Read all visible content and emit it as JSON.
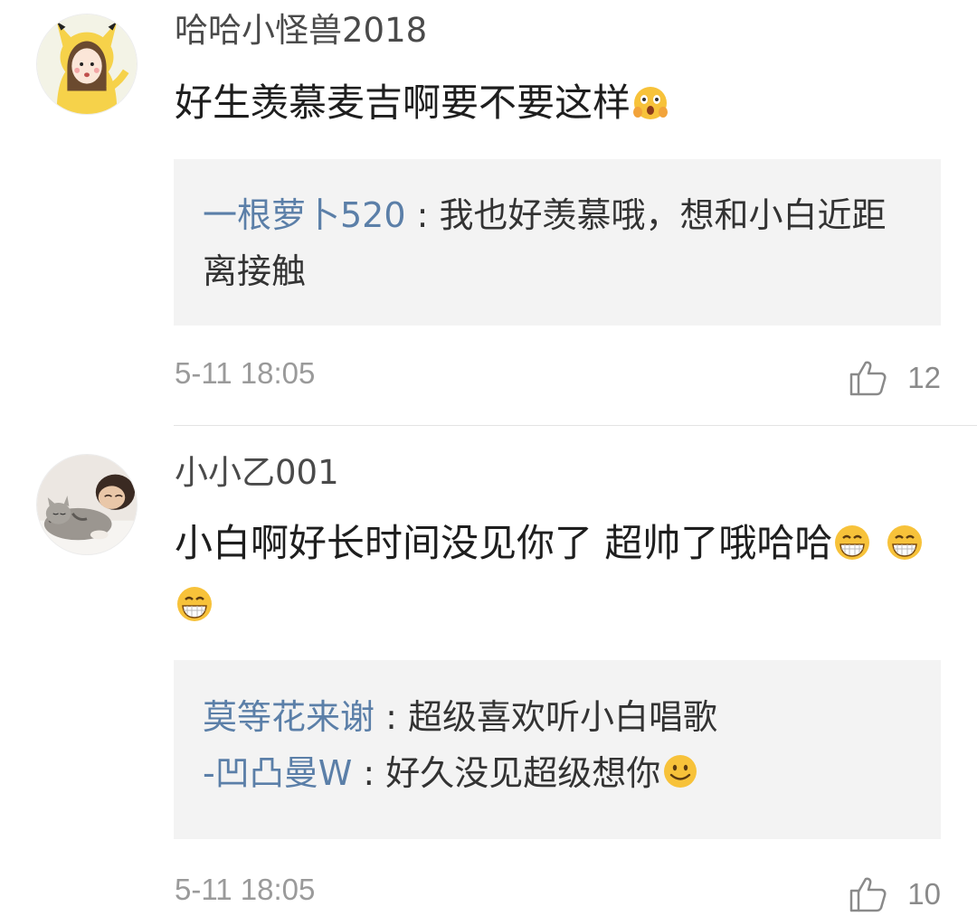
{
  "comments": [
    {
      "username": "哈哈小怪兽2018",
      "text": "好生羡慕麦吉啊要不要这样",
      "emoji_icon": "scared-face-emoji",
      "avatar_icon": "pikachu-hoodie-girl-avatar",
      "replies": [
        {
          "author": "一根萝卜520",
          "separator": " : ",
          "text": "我也好羡慕哦，想和小白近距离接触"
        }
      ],
      "timestamp": "5-11 18:05",
      "likes": "12"
    },
    {
      "username": "小小乙001",
      "text": "小白啊好长时间没见你了 超帅了哦哈哈",
      "emoji_icon": "grinning-face-emoji",
      "avatar_icon": "sleeping-cat-avatar",
      "replies": [
        {
          "author": "莫等花来谢",
          "separator": " : ",
          "text": "超级喜欢听小白唱歌"
        },
        {
          "author": "-凹凸曼W",
          "separator": " : ",
          "text": "好久没见超级想你",
          "emoji_icon": "smiley-face-emoji"
        }
      ],
      "timestamp": "5-11 18:05",
      "likes": "10"
    }
  ],
  "colors": {
    "reply_author": "#5b7fa8",
    "reply_bg": "#f3f3f3",
    "meta_text": "#9a9a9a"
  }
}
